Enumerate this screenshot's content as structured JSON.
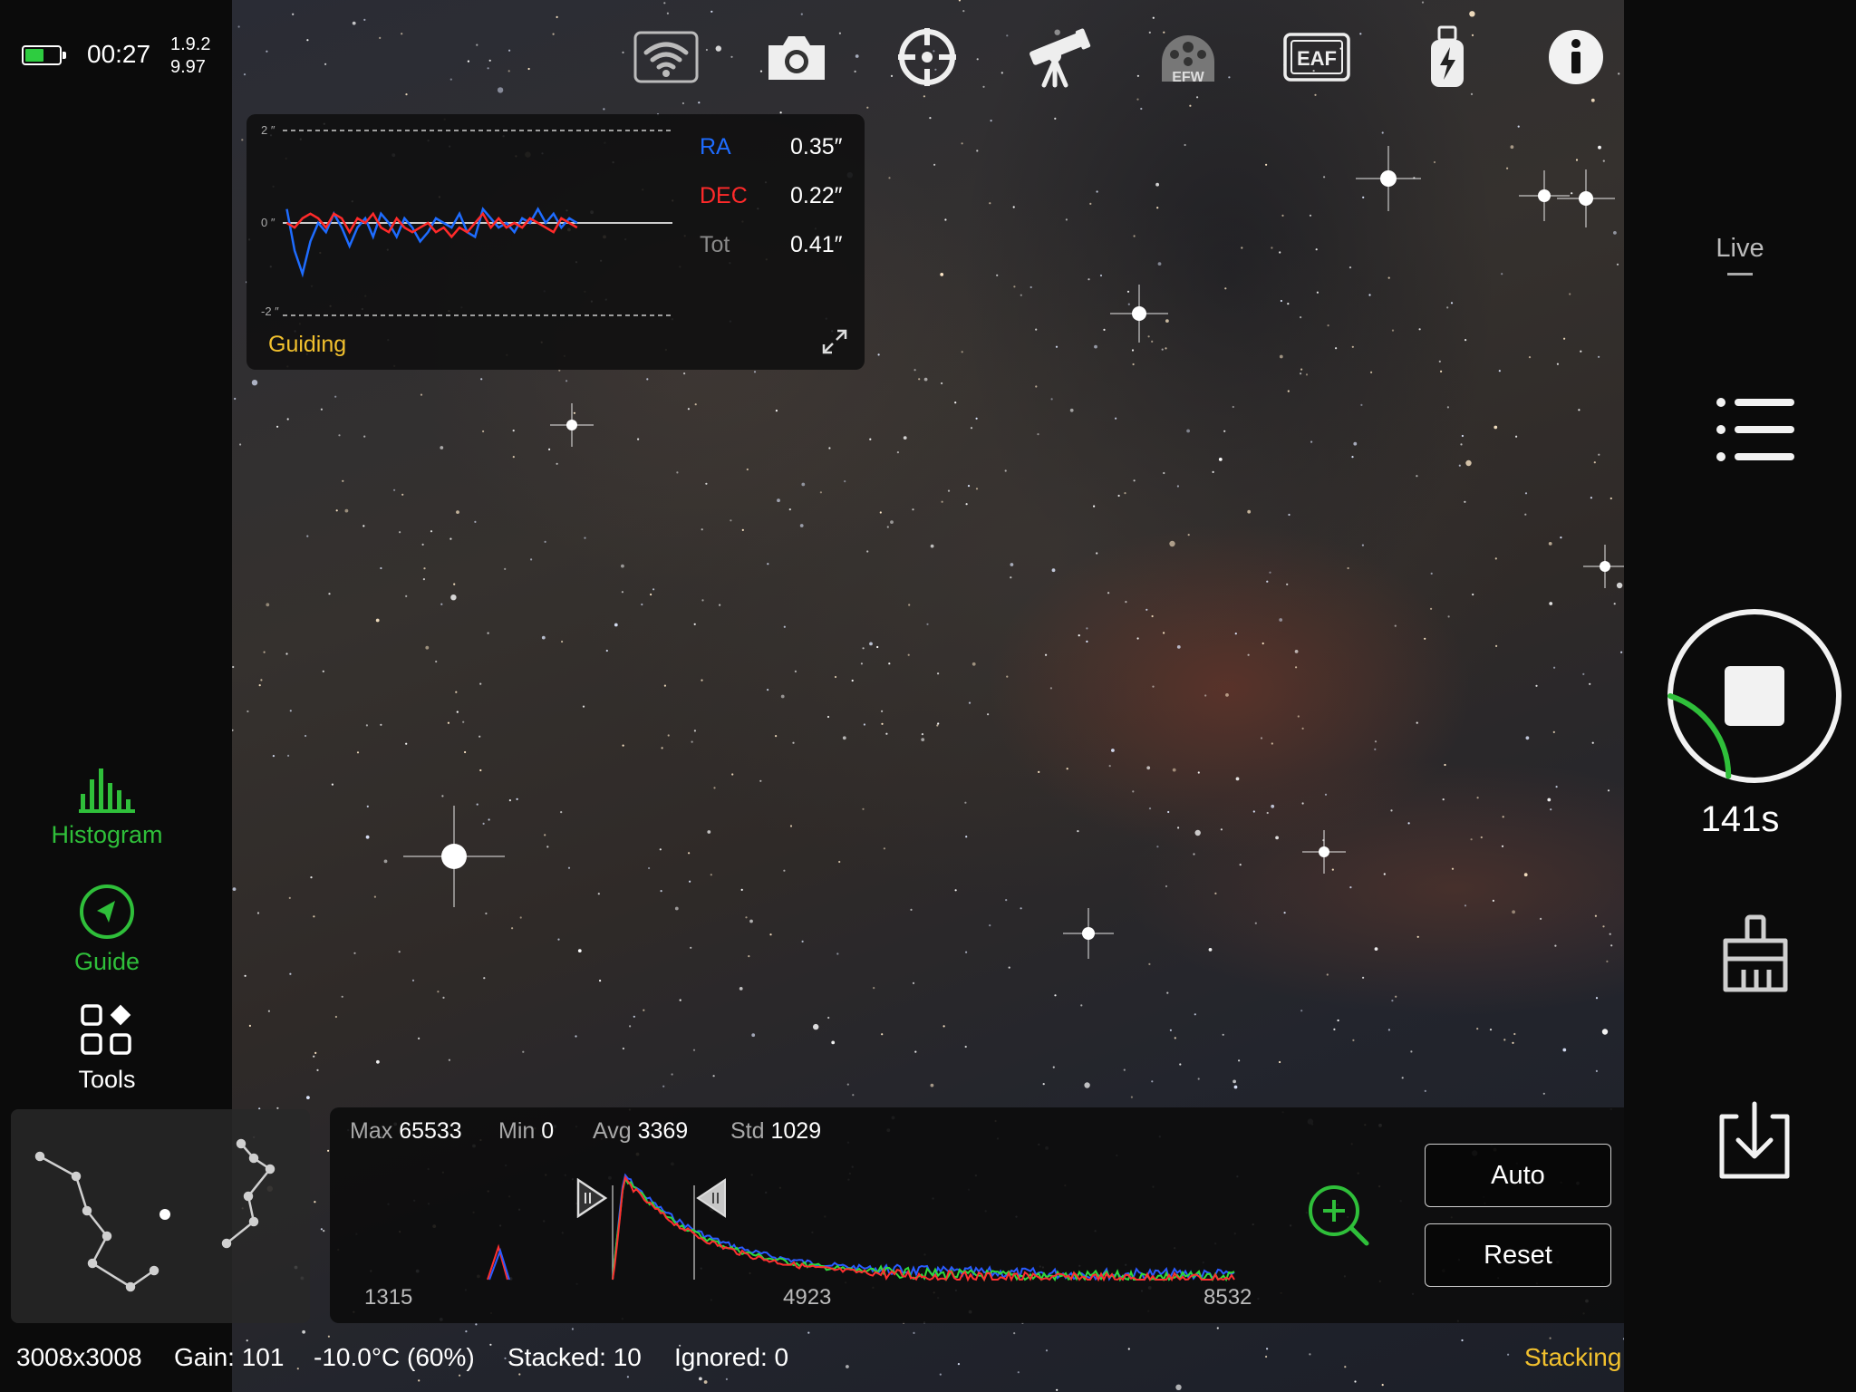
{
  "status_top": {
    "battery_level": 0.55,
    "time": "00:27",
    "version_line1": "1.9.2",
    "version_line2": "9.97"
  },
  "toolbar": {
    "icons": [
      "wifi-icon",
      "camera-icon",
      "guide-crosshair-icon",
      "telescope-mount-icon",
      "efw-filter-wheel-icon",
      "eaf-focuser-icon",
      "usb-storage-icon",
      "info-icon"
    ],
    "efw_label": "EFW",
    "eaf_label": "EAF"
  },
  "guiding": {
    "title": "Guiding",
    "axis_top": "2 ″",
    "axis_mid": "0 ″",
    "axis_bottom": "-2 ″",
    "ra_label": "RA",
    "ra_value": "0.35″",
    "dec_label": "DEC",
    "dec_value": "0.22″",
    "tot_label": "Tot",
    "tot_value": "0.41″",
    "ra_series": [
      0.3,
      -0.6,
      -1.1,
      -0.4,
      0.0,
      -0.2,
      0.2,
      -0.1,
      -0.5,
      -0.1,
      0.1,
      -0.3,
      0.2,
      0.0,
      -0.3,
      0.1,
      -0.1,
      -0.4,
      -0.2,
      0.1,
      0.0,
      -0.1,
      0.2,
      -0.2,
      -0.3,
      0.3,
      0.1,
      -0.1,
      0.0,
      -0.2,
      0.1,
      0.0,
      0.3,
      0.0,
      0.2,
      -0.1,
      0.1,
      0.0
    ],
    "dec_series": [
      0.0,
      -0.1,
      0.1,
      0.2,
      0.1,
      -0.1,
      0.2,
      0.1,
      -0.2,
      0.1,
      0.0,
      0.2,
      -0.1,
      -0.2,
      0.1,
      -0.1,
      -0.2,
      -0.1,
      0.0,
      -0.2,
      -0.1,
      -0.3,
      -0.1,
      -0.2,
      0.0,
      0.2,
      -0.1,
      0.1,
      -0.1,
      0.0,
      -0.1,
      0.1,
      0.0,
      -0.1,
      -0.2,
      0.1,
      0.0,
      -0.1
    ],
    "colors": {
      "ra": "#1e6cff",
      "dec": "#ff2a2a",
      "title": "#f2c12e"
    }
  },
  "left_nav": {
    "histogram_label": "Histogram",
    "guide_label": "Guide",
    "tools_label": "Tools",
    "active_color": "#2fbf3a"
  },
  "histogram": {
    "max_label": "Max",
    "max_value": "65533",
    "min_label": "Min",
    "min_value": "0",
    "avg_label": "Avg",
    "avg_value": "3369",
    "std_label": "Std",
    "std_value": "1029",
    "x_left": "1315",
    "x_mid": "4923",
    "x_right": "8532",
    "auto_label": "Auto",
    "reset_label": "Reset"
  },
  "status_bar": {
    "resolution": "3008x3008",
    "gain": "Gain: 101",
    "temperature": "-10.0°C (60%)",
    "stacked": "Stacked: 10",
    "ignored": "Ignored: 0",
    "mode": "Stacking",
    "mode_color": "#f2c12e"
  },
  "right_bar": {
    "live_label": "Live",
    "timer": "141s",
    "progress": 0.2
  }
}
